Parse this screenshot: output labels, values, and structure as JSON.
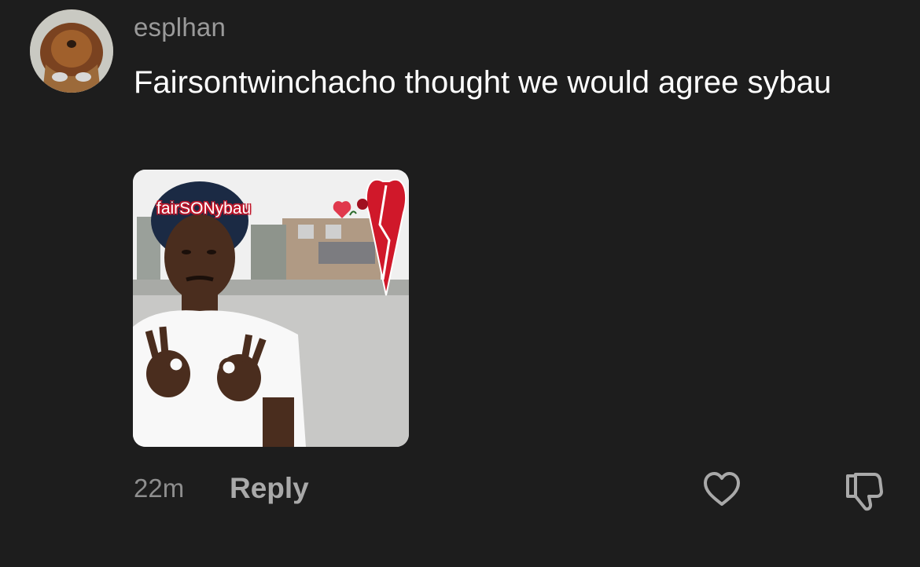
{
  "comment": {
    "username": "esplhan",
    "text": "Fairsontwinchacho thought we would agree sybau",
    "media": {
      "caption": "fairSONybau"
    },
    "time": "22m",
    "reply_label": "Reply"
  },
  "icons": {
    "like": "heart-outline-icon",
    "dislike": "thumbs-down-outline-icon"
  },
  "colors": {
    "background": "#1d1d1d",
    "username": "#9a9a9a",
    "text": "#ffffff",
    "meta": "#8e8e8e"
  }
}
